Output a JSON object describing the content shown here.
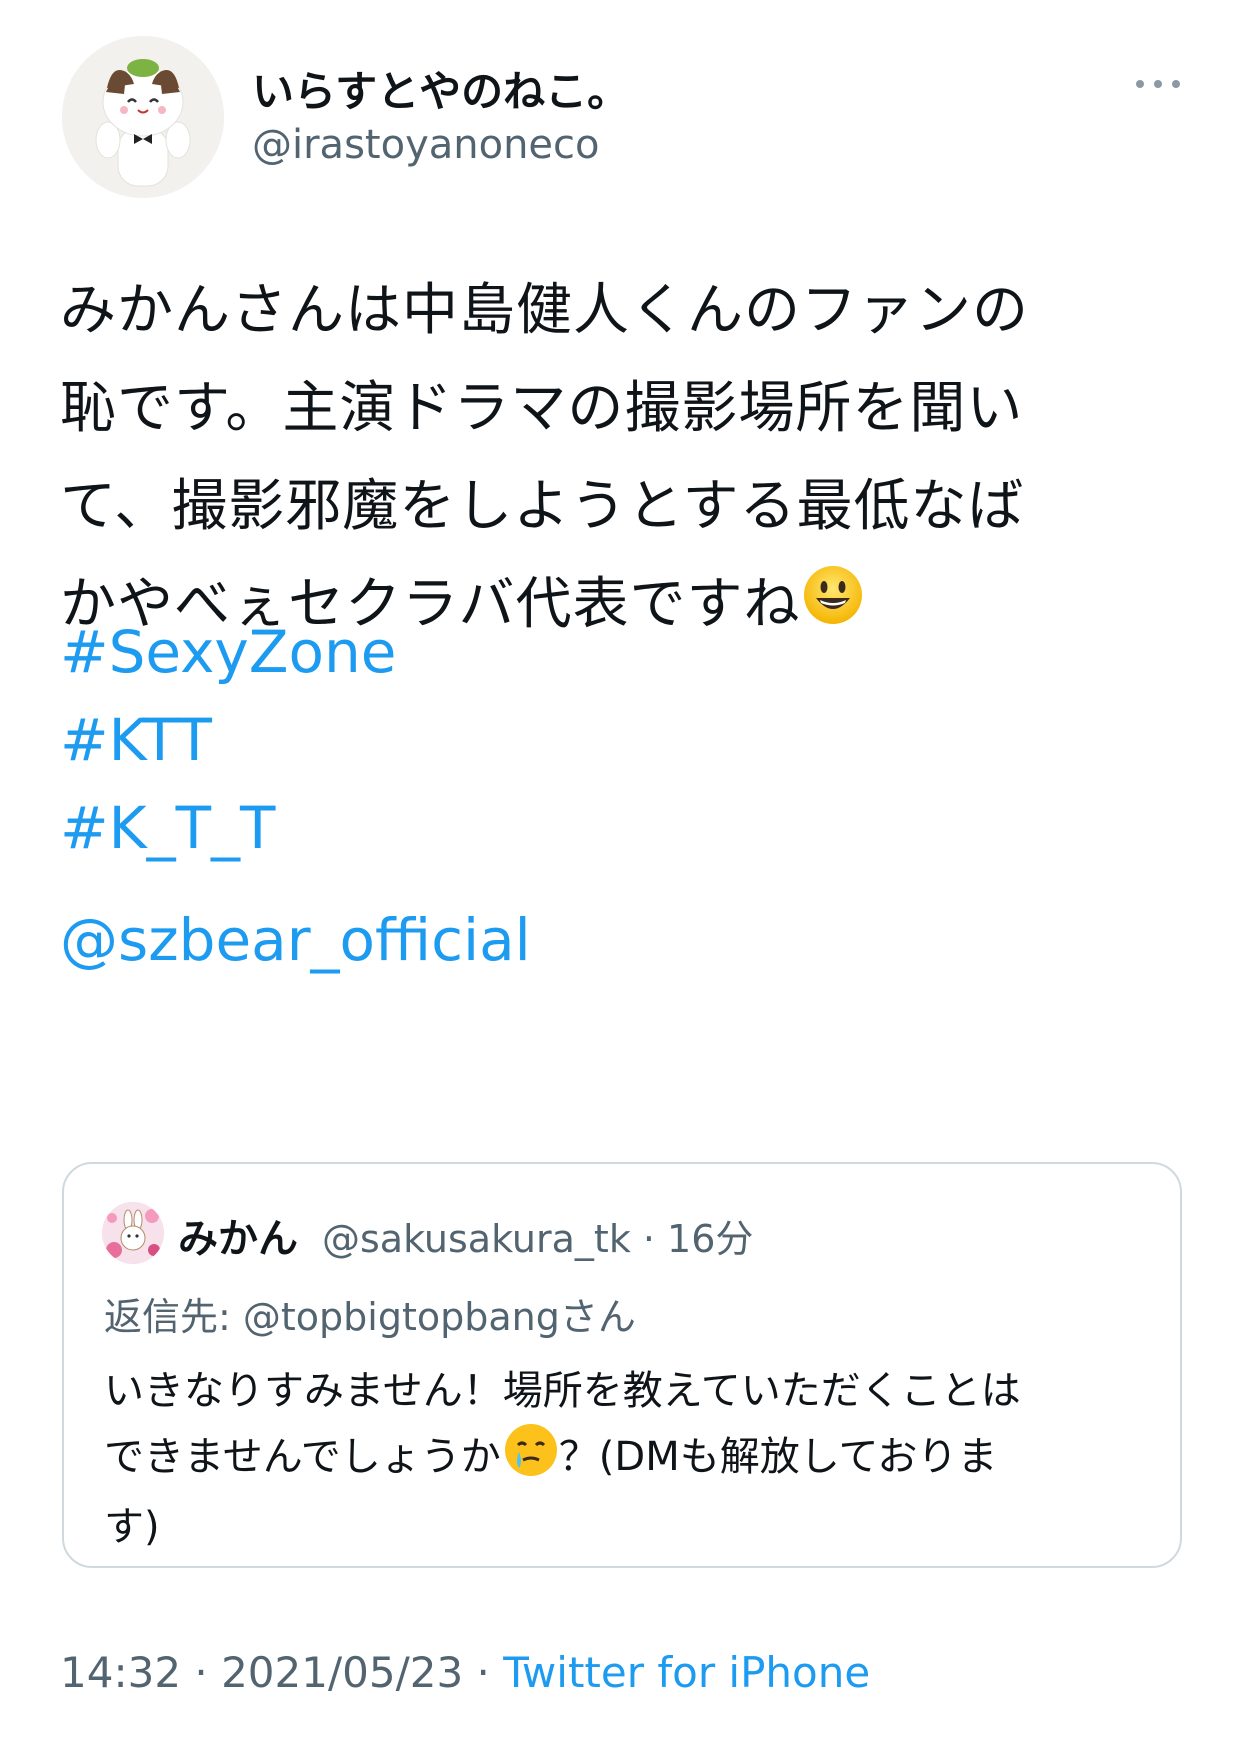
{
  "author": {
    "display_name": "いらすとやのねこ。",
    "handle": "@irastoyanoneco",
    "avatar_icon": "cat-plush-avatar"
  },
  "more_icon": "more-dots-icon",
  "tweet": {
    "lines": [
      "みかんさんは中島健人くんのファンの",
      "恥です。主演ドラマの撮影場所を聞い",
      "て、撮影邪魔をしようとする最低なば",
      "かやべぇセクラバ代表ですね"
    ],
    "emoji": "smiley-face-emoji",
    "hashtags": [
      "#SexyZone",
      "#KTT",
      "#K_T_T"
    ],
    "mention": "@szbear_official"
  },
  "quoted": {
    "display_name": "みかん",
    "meta": "@sakusakura_tk · 16分",
    "reply_label": "返信先: ",
    "reply_handle": "@topbigtopbangさん",
    "body_lines": [
      "いきなりすみません！場所を教えていただくことは",
      "できませんでしょうか",
      "？(DMも解放しておりま",
      "す)"
    ],
    "emoji": "crying-smile-emoji",
    "avatar_icon": "bunny-flower-avatar"
  },
  "footer": {
    "time_date": "14:32 · 2021/05/23 · ",
    "source": "Twitter for iPhone"
  },
  "colors": {
    "link": "#1d9bf0",
    "secondary": "#536471",
    "border": "#cfd9de"
  }
}
